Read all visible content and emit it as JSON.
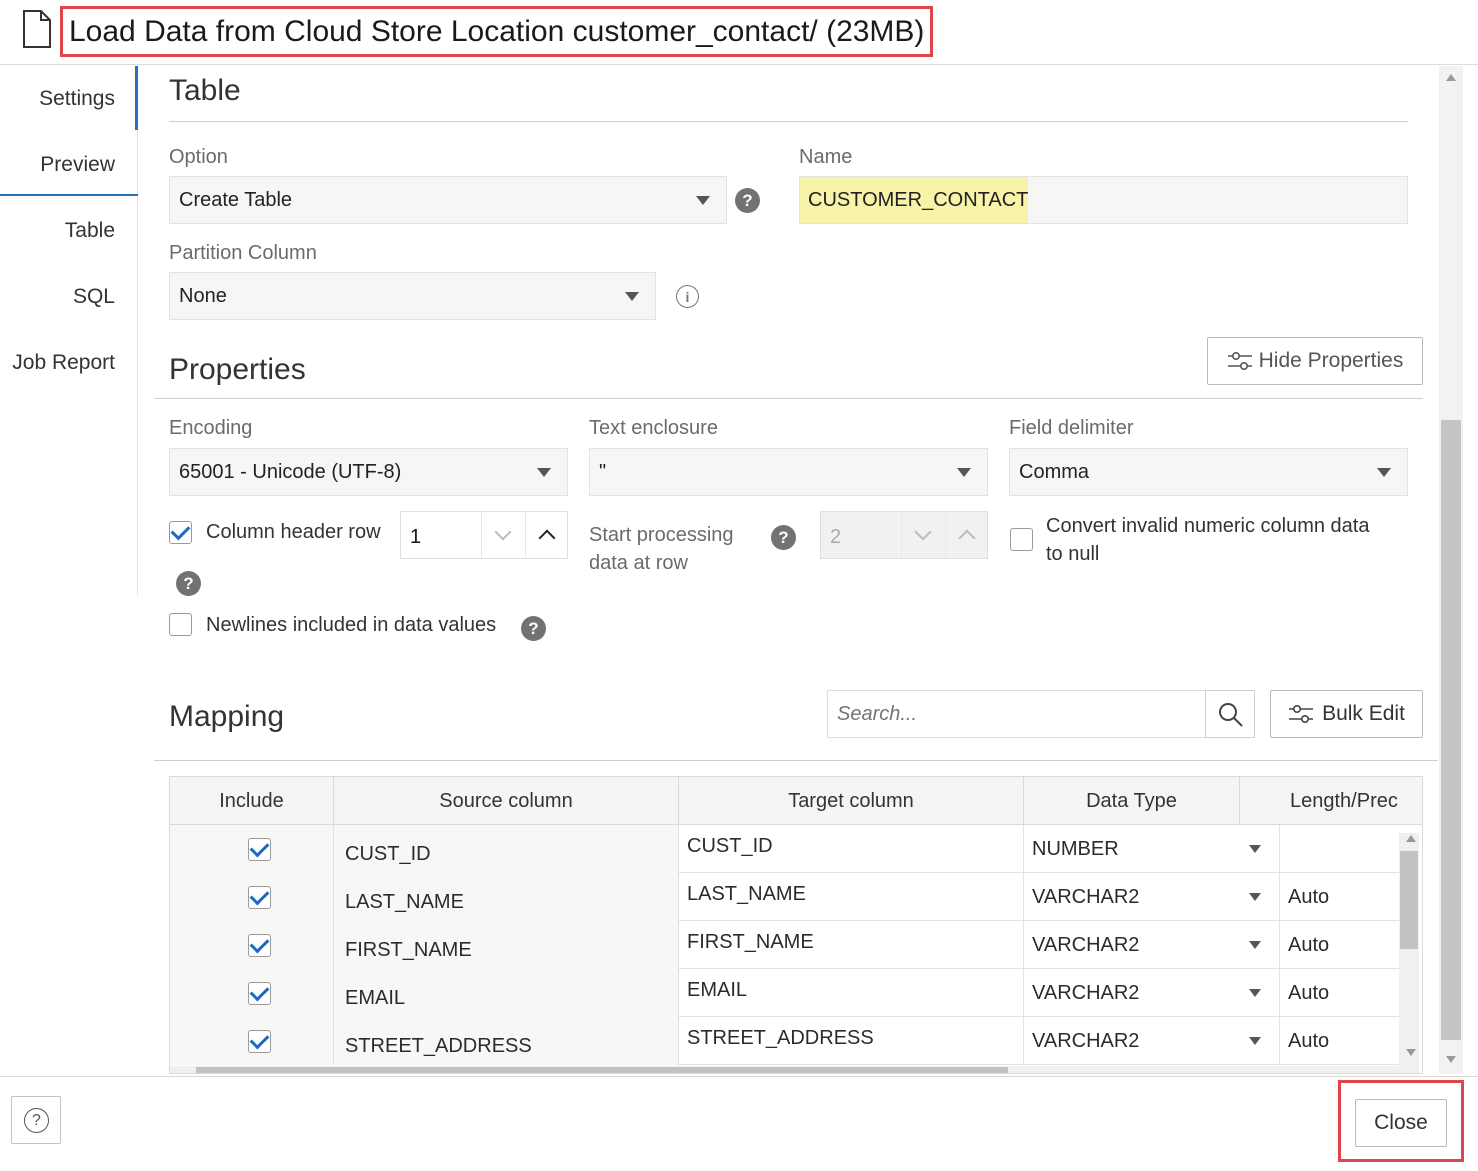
{
  "header": {
    "title": "Load Data from Cloud Store Location customer_contact/ (23MB)",
    "icon": "document-icon"
  },
  "nav": {
    "items": [
      {
        "label": "Settings",
        "active": true
      },
      {
        "label": "Preview"
      },
      {
        "label": "Table"
      },
      {
        "label": "SQL"
      },
      {
        "label": "Job Report"
      }
    ]
  },
  "table_section": {
    "heading": "Table",
    "option_label": "Option",
    "option_value": "Create Table",
    "name_label": "Name",
    "name_value": "CUSTOMER_CONTACT",
    "partition_label": "Partition Column",
    "partition_value": "None"
  },
  "properties": {
    "heading": "Properties",
    "hide_button": "Hide Properties",
    "encoding_label": "Encoding",
    "encoding_value": "65001 - Unicode (UTF-8)",
    "enclosure_label": "Text enclosure",
    "enclosure_value": "\"",
    "delimiter_label": "Field delimiter",
    "delimiter_value": "Comma",
    "column_header_label": "Column header row",
    "column_header_checked": true,
    "column_header_value": "1",
    "start_processing_label_1": "Start processing",
    "start_processing_label_2": "data at row",
    "start_processing_value": "2",
    "convert_label_1": "Convert invalid numeric column data",
    "convert_label_2": "to null",
    "convert_checked": false,
    "newlines_label": "Newlines included in data values",
    "newlines_checked": false
  },
  "mapping": {
    "heading": "Mapping",
    "search_placeholder": "Search...",
    "bulk_edit": "Bulk Edit",
    "columns": [
      "Include",
      "Source column",
      "Target column",
      "Data Type",
      "Length/Prec"
    ],
    "rows": [
      {
        "include": true,
        "source": "CUST_ID",
        "target": "CUST_ID",
        "type": "NUMBER",
        "length": ""
      },
      {
        "include": true,
        "source": "LAST_NAME",
        "target": "LAST_NAME",
        "type": "VARCHAR2",
        "length": "Auto"
      },
      {
        "include": true,
        "source": "FIRST_NAME",
        "target": "FIRST_NAME",
        "type": "VARCHAR2",
        "length": "Auto"
      },
      {
        "include": true,
        "source": "EMAIL",
        "target": "EMAIL",
        "type": "VARCHAR2",
        "length": "Auto"
      },
      {
        "include": true,
        "source": "STREET_ADDRESS",
        "target": "STREET_ADDRESS",
        "type": "VARCHAR2",
        "length": "Auto"
      }
    ]
  },
  "footer": {
    "help_glyph": "?",
    "close_label": "Close"
  },
  "colors": {
    "highlight": "#e0454b",
    "accent": "#2a6fbe",
    "name_highlight": "#f7f3a8"
  }
}
